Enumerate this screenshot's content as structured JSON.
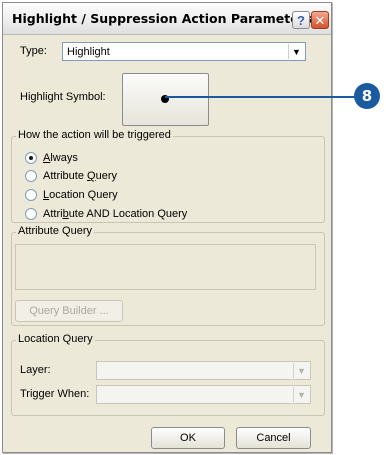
{
  "window": {
    "title": "Highlight / Suppression Action Parameters",
    "help_label": "?",
    "close_label": "✕"
  },
  "type_row": {
    "label": "Type:",
    "value": "Highlight"
  },
  "highlight_symbol": {
    "label": "Highlight Symbol:"
  },
  "trigger_group": {
    "title": "How the action will be triggered",
    "options": [
      {
        "label": "Always",
        "underline": "A",
        "selected": true
      },
      {
        "label": "Attribute Query",
        "underline": "Q",
        "selected": false
      },
      {
        "label": "Location Query",
        "underline": "L",
        "selected": false
      },
      {
        "label": "Attribute AND Location Query",
        "underline": "b",
        "selected": false
      }
    ]
  },
  "attribute_query_group": {
    "title": "Attribute Query",
    "query_builder_label": "Query Builder ..."
  },
  "location_query_group": {
    "title": "Location Query",
    "layer_label": "Layer:",
    "trigger_when_label": "Trigger When:",
    "layer_value": "",
    "trigger_when_value": ""
  },
  "buttons": {
    "ok": "OK",
    "cancel": "Cancel"
  },
  "callout": {
    "number": "8"
  },
  "colors": {
    "callout": "#1c5aa0",
    "dialog_bg": "#ece9d8"
  }
}
